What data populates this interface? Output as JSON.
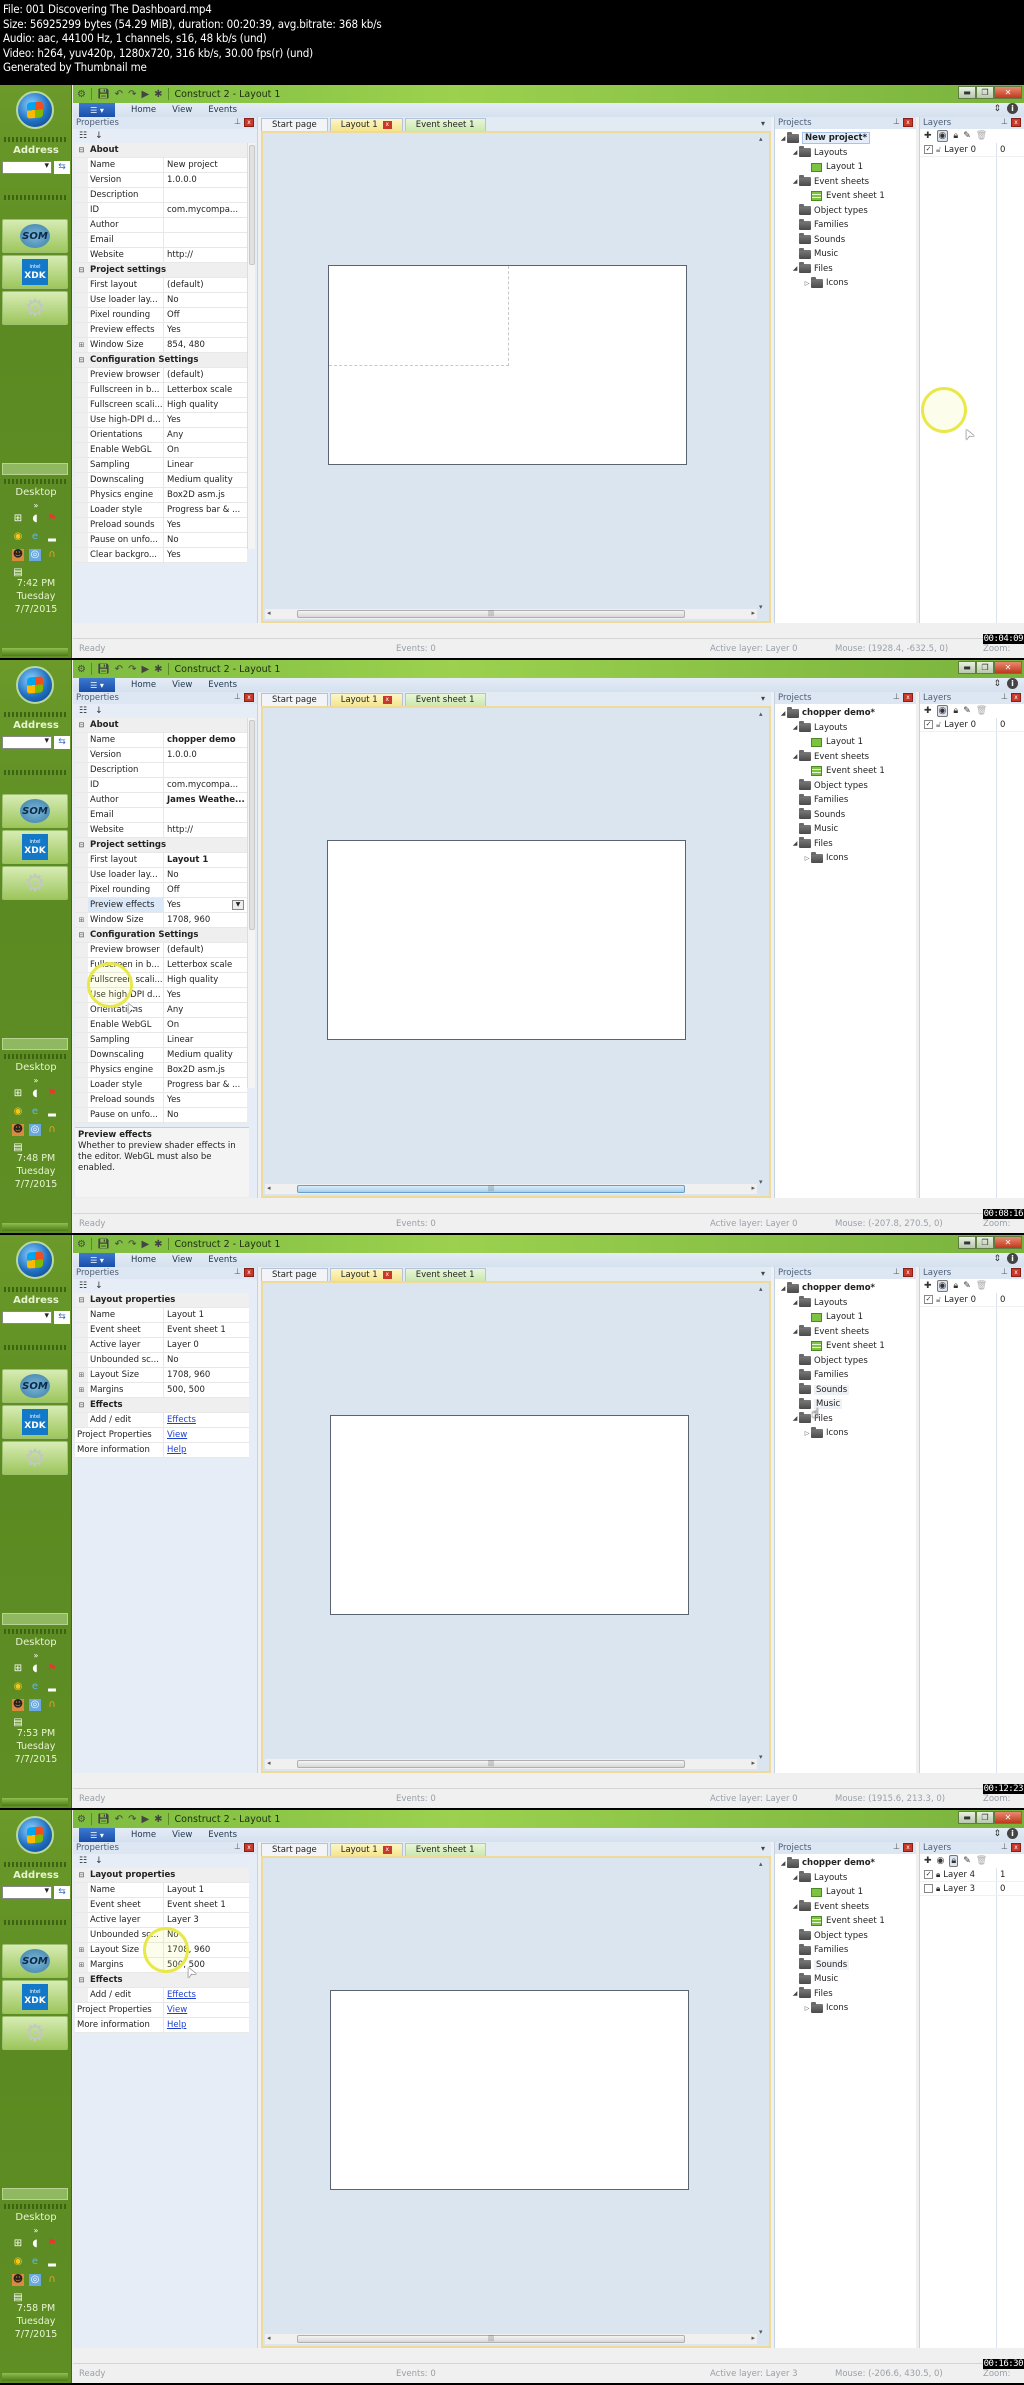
{
  "file_info": {
    "line1": "File: 001 Discovering The Dashboard.mp4",
    "line2": "Size: 56925299 bytes (54.29 MiB), duration: 00:20:39, avg.bitrate: 368 kb/s",
    "line3": "Audio: aac, 44100 Hz, 1 channels, s16, 48 kb/s (und)",
    "line4": "Video: h264, yuv420p, 1280x720, 316 kb/s, 30.00 fps(r) (und)",
    "line5": "Generated by Thumbnail me"
  },
  "taskbar": {
    "address_label": "Address",
    "som_label": "SOM",
    "xdk_brand": "intel",
    "xdk_label": "XDK",
    "desktop_label": "Desktop",
    "day": "Tuesday",
    "date": "7/7/2015"
  },
  "app": {
    "title": "Construct 2 - Layout 1",
    "ribbon_tabs": [
      "Home",
      "View",
      "Events"
    ],
    "properties_title": "Properties",
    "projects_title": "Projects",
    "layers_title": "Layers",
    "doc_tabs": [
      "Start page",
      "Layout 1",
      "Event sheet 1"
    ],
    "status_ready": "Ready",
    "status_events": "Events: 0",
    "zoom_label": "Zoom:"
  },
  "frames": [
    {
      "clock": "7:42 PM",
      "timestamp": "00:04:09",
      "properties": [
        {
          "type": "cat",
          "name": "About"
        },
        {
          "name": "Name",
          "value": "New project"
        },
        {
          "name": "Version",
          "value": "1.0.0.0"
        },
        {
          "name": "Description",
          "value": ""
        },
        {
          "name": "ID",
          "value": "com.mycompa..."
        },
        {
          "name": "Author",
          "value": ""
        },
        {
          "name": "Email",
          "value": ""
        },
        {
          "name": "Website",
          "value": "http://"
        },
        {
          "type": "cat",
          "name": "Project settings"
        },
        {
          "name": "First layout",
          "value": "(default)"
        },
        {
          "name": "Use loader lay...",
          "value": "No"
        },
        {
          "name": "Pixel rounding",
          "value": "Off"
        },
        {
          "name": "Preview effects",
          "value": "Yes"
        },
        {
          "name": "Window Size",
          "value": "854, 480",
          "expand": true
        },
        {
          "type": "cat",
          "name": "Configuration Settings"
        },
        {
          "name": "Preview browser",
          "value": "(default)"
        },
        {
          "name": "Fullscreen in b...",
          "value": "Letterbox scale"
        },
        {
          "name": "Fullscreen scali...",
          "value": "High quality"
        },
        {
          "name": "Use high-DPI d...",
          "value": "Yes"
        },
        {
          "name": "Orientations",
          "value": "Any"
        },
        {
          "name": "Enable WebGL",
          "value": "On"
        },
        {
          "name": "Sampling",
          "value": "Linear"
        },
        {
          "name": "Downscaling",
          "value": "Medium quality"
        },
        {
          "name": "Physics engine",
          "value": "Box2D asm.js"
        },
        {
          "name": "Loader style",
          "value": "Progress bar & ..."
        },
        {
          "name": "Preload sounds",
          "value": "Yes"
        },
        {
          "name": "Pause on unfo...",
          "value": "No"
        },
        {
          "name": "Clear backgro...",
          "value": "Yes"
        }
      ],
      "tree": [
        {
          "label": "New project*",
          "level": 0,
          "arrow": "open",
          "icon": "folder",
          "bold": true,
          "selected": true
        },
        {
          "label": "Layouts",
          "level": 1,
          "arrow": "open",
          "icon": "folder"
        },
        {
          "label": "Layout 1",
          "level": 2,
          "icon": "layout"
        },
        {
          "label": "Event sheets",
          "level": 1,
          "arrow": "open",
          "icon": "folder"
        },
        {
          "label": "Event sheet 1",
          "level": 2,
          "icon": "sheet"
        },
        {
          "label": "Object types",
          "level": 1,
          "icon": "folder"
        },
        {
          "label": "Families",
          "level": 1,
          "icon": "folder"
        },
        {
          "label": "Sounds",
          "level": 1,
          "icon": "folder"
        },
        {
          "label": "Music",
          "level": 1,
          "icon": "folder"
        },
        {
          "label": "Files",
          "level": 1,
          "arrow": "open",
          "icon": "folder"
        },
        {
          "label": "Icons",
          "level": 2,
          "arrow": "closed",
          "icon": "folder"
        }
      ],
      "layers": [
        {
          "name": "Layer 0",
          "index": "0",
          "visible": true,
          "locked": false
        }
      ],
      "active_layer": "Active layer: Layer 0",
      "mouse": "Mouse: (1928.4, -632.5, 0)"
    },
    {
      "clock": "7:48 PM",
      "timestamp": "00:08:16",
      "properties": [
        {
          "type": "cat",
          "name": "About"
        },
        {
          "name": "Name",
          "value": "chopper demo",
          "bold": true
        },
        {
          "name": "Version",
          "value": "1.0.0.0"
        },
        {
          "name": "Description",
          "value": ""
        },
        {
          "name": "ID",
          "value": "com.mycompa..."
        },
        {
          "name": "Author",
          "value": "James Weathe...",
          "bold": true
        },
        {
          "name": "Email",
          "value": ""
        },
        {
          "name": "Website",
          "value": "http://"
        },
        {
          "type": "cat",
          "name": "Project settings"
        },
        {
          "name": "First layout",
          "value": "Layout 1",
          "bold": true
        },
        {
          "name": "Use loader lay...",
          "value": "No"
        },
        {
          "name": "Pixel rounding",
          "value": "Off"
        },
        {
          "name": "Preview effects",
          "value": "Yes",
          "selected": true,
          "dropdown": true
        },
        {
          "name": "Window Size",
          "value": "1708, 960",
          "expand": true
        },
        {
          "type": "cat",
          "name": "Configuration Settings"
        },
        {
          "name": "Preview browser",
          "value": "(default)"
        },
        {
          "name": "Fullscreen in b...",
          "value": "Letterbox scale"
        },
        {
          "name": "Fullscreen scali...",
          "value": "High quality"
        },
        {
          "name": "Use high-DPI d...",
          "value": "Yes"
        },
        {
          "name": "Orientations",
          "value": "Any"
        },
        {
          "name": "Enable WebGL",
          "value": "On"
        },
        {
          "name": "Sampling",
          "value": "Linear"
        },
        {
          "name": "Downscaling",
          "value": "Medium quality"
        },
        {
          "name": "Physics engine",
          "value": "Box2D asm.js"
        },
        {
          "name": "Loader style",
          "value": "Progress bar & ..."
        },
        {
          "name": "Preload sounds",
          "value": "Yes"
        },
        {
          "name": "Pause on unfo...",
          "value": "No"
        }
      ],
      "description": {
        "title": "Preview effects",
        "text": "Whether to preview shader effects in the editor. WebGL must also be enabled."
      },
      "tree": [
        {
          "label": "chopper demo*",
          "level": 0,
          "arrow": "open",
          "icon": "folder",
          "bold": true
        },
        {
          "label": "Layouts",
          "level": 1,
          "arrow": "open",
          "icon": "folder"
        },
        {
          "label": "Layout 1",
          "level": 2,
          "icon": "layout"
        },
        {
          "label": "Event sheets",
          "level": 1,
          "arrow": "open",
          "icon": "folder"
        },
        {
          "label": "Event sheet 1",
          "level": 2,
          "icon": "sheet"
        },
        {
          "label": "Object types",
          "level": 1,
          "icon": "folder"
        },
        {
          "label": "Families",
          "level": 1,
          "icon": "folder"
        },
        {
          "label": "Sounds",
          "level": 1,
          "icon": "folder"
        },
        {
          "label": "Music",
          "level": 1,
          "icon": "folder"
        },
        {
          "label": "Files",
          "level": 1,
          "arrow": "open",
          "icon": "folder"
        },
        {
          "label": "Icons",
          "level": 2,
          "arrow": "closed",
          "icon": "folder"
        }
      ],
      "layers": [
        {
          "name": "Layer 0",
          "index": "0",
          "visible": true,
          "locked": false
        }
      ],
      "active_layer": "Active layer: Layer 0",
      "mouse": "Mouse: (-207.8, 270.5, 0)"
    },
    {
      "clock": "7:53 PM",
      "timestamp": "00:12:23",
      "properties": [
        {
          "type": "cat",
          "name": "Layout properties"
        },
        {
          "name": "Name",
          "value": "Layout 1"
        },
        {
          "name": "Event sheet",
          "value": "Event sheet 1"
        },
        {
          "name": "Active layer",
          "value": "Layer 0"
        },
        {
          "name": "Unbounded sc...",
          "value": "No"
        },
        {
          "name": "Layout Size",
          "value": "1708, 960",
          "expand": true
        },
        {
          "name": "Margins",
          "value": "500, 500",
          "expand": true
        },
        {
          "type": "cat",
          "name": "Effects"
        },
        {
          "name": "Add / edit",
          "value": "Effects",
          "link": true
        },
        {
          "type": "top",
          "name": "Project Properties",
          "value": "View",
          "link": true
        },
        {
          "type": "top",
          "name": "More information",
          "value": "Help",
          "link": true
        }
      ],
      "tree": [
        {
          "label": "chopper demo*",
          "level": 0,
          "arrow": "open",
          "icon": "folder",
          "bold": true
        },
        {
          "label": "Layouts",
          "level": 1,
          "arrow": "open",
          "icon": "folder"
        },
        {
          "label": "Layout 1",
          "level": 2,
          "icon": "layout"
        },
        {
          "label": "Event sheets",
          "level": 1,
          "arrow": "open",
          "icon": "folder"
        },
        {
          "label": "Event sheet 1",
          "level": 2,
          "icon": "sheet"
        },
        {
          "label": "Object types",
          "level": 1,
          "icon": "folder"
        },
        {
          "label": "Families",
          "level": 1,
          "icon": "folder"
        },
        {
          "label": "Sounds",
          "level": 1,
          "icon": "folder",
          "highlight": true
        },
        {
          "label": "Music",
          "level": 1,
          "icon": "folder",
          "highlight": true
        },
        {
          "label": "Files",
          "level": 1,
          "arrow": "open",
          "icon": "folder"
        },
        {
          "label": "Icons",
          "level": 2,
          "arrow": "closed",
          "icon": "folder"
        }
      ],
      "layers": [
        {
          "name": "Layer 0",
          "index": "0",
          "visible": true,
          "locked": false
        }
      ],
      "active_layer": "Active layer: Layer 0",
      "mouse": "Mouse: (1915.6, 213.3, 0)"
    },
    {
      "clock": "7:58 PM",
      "timestamp": "00:16:30",
      "properties": [
        {
          "type": "cat",
          "name": "Layout properties"
        },
        {
          "name": "Name",
          "value": "Layout 1"
        },
        {
          "name": "Event sheet",
          "value": "Event sheet 1"
        },
        {
          "name": "Active layer",
          "value": "Layer 3"
        },
        {
          "name": "Unbounded sc...",
          "value": "No"
        },
        {
          "name": "Layout Size",
          "value": "1708, 960",
          "expand": true
        },
        {
          "name": "Margins",
          "value": "500, 500",
          "expand": true
        },
        {
          "type": "cat",
          "name": "Effects"
        },
        {
          "name": "Add / edit",
          "value": "Effects",
          "link": true
        },
        {
          "type": "top",
          "name": "Project Properties",
          "value": "View",
          "link": true
        },
        {
          "type": "top",
          "name": "More information",
          "value": "Help",
          "link": true
        }
      ],
      "tree": [
        {
          "label": "chopper demo*",
          "level": 0,
          "arrow": "open",
          "icon": "folder",
          "bold": true
        },
        {
          "label": "Layouts",
          "level": 1,
          "arrow": "open",
          "icon": "folder"
        },
        {
          "label": "Layout 1",
          "level": 2,
          "icon": "layout"
        },
        {
          "label": "Event sheets",
          "level": 1,
          "arrow": "open",
          "icon": "folder"
        },
        {
          "label": "Event sheet 1",
          "level": 2,
          "icon": "sheet"
        },
        {
          "label": "Object types",
          "level": 1,
          "icon": "folder"
        },
        {
          "label": "Families",
          "level": 1,
          "icon": "folder"
        },
        {
          "label": "Sounds",
          "level": 1,
          "icon": "folder",
          "highlight": true
        },
        {
          "label": "Music",
          "level": 1,
          "icon": "folder"
        },
        {
          "label": "Files",
          "level": 1,
          "arrow": "open",
          "icon": "folder"
        },
        {
          "label": "Icons",
          "level": 2,
          "arrow": "closed",
          "icon": "folder"
        }
      ],
      "layers": [
        {
          "name": "Layer 4",
          "index": "1",
          "visible": true,
          "locked": true
        },
        {
          "name": "Layer 3",
          "index": "0",
          "visible": false,
          "locked": true
        }
      ],
      "lock_tool_active": true,
      "active_layer": "Active layer: Layer 3",
      "mouse": "Mouse: (-206.6, 430.5, 0)"
    }
  ]
}
